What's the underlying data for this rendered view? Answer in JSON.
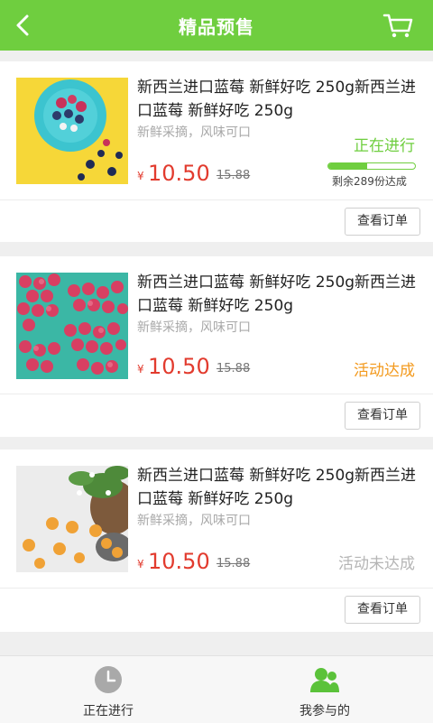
{
  "header": {
    "title": "精品预售",
    "back_icon": "back-arrow-icon",
    "cart_icon": "cart-icon"
  },
  "colors": {
    "brand": "#6fce3f",
    "price": "#e23b2e",
    "status_running": "#6fce3f",
    "status_done": "#f39a1e",
    "status_failed": "#b5b5b5"
  },
  "products": [
    {
      "name": "新西兰进口蓝莓 新鲜好吃 250g新西兰进口蓝莓 新鲜好吃 250g",
      "sub": "新鲜采摘，风味可口",
      "currency": "¥",
      "price": "10.50",
      "old_price": "15.88",
      "status": "正在进行",
      "progress": 0.45,
      "remaining": "剩余289份达成",
      "button": "查看订单"
    },
    {
      "name": "新西兰进口蓝莓 新鲜好吃 250g新西兰进口蓝莓 新鲜好吃 250g",
      "sub": "新鲜采摘，风味可口",
      "currency": "¥",
      "price": "10.50",
      "old_price": "15.88",
      "status": "活动达成",
      "button": "查看订单"
    },
    {
      "name": "新西兰进口蓝莓 新鲜好吃 250g新西兰进口蓝莓 新鲜好吃 250g",
      "sub": "新鲜采摘，风味可口",
      "currency": "¥",
      "price": "10.50",
      "old_price": "15.88",
      "status": "活动未达成",
      "button": "查看订单"
    }
  ],
  "tabbar": {
    "tabs": [
      {
        "label": "正在进行",
        "icon": "clock-icon"
      },
      {
        "label": "我参与的",
        "icon": "users-icon"
      }
    ]
  }
}
